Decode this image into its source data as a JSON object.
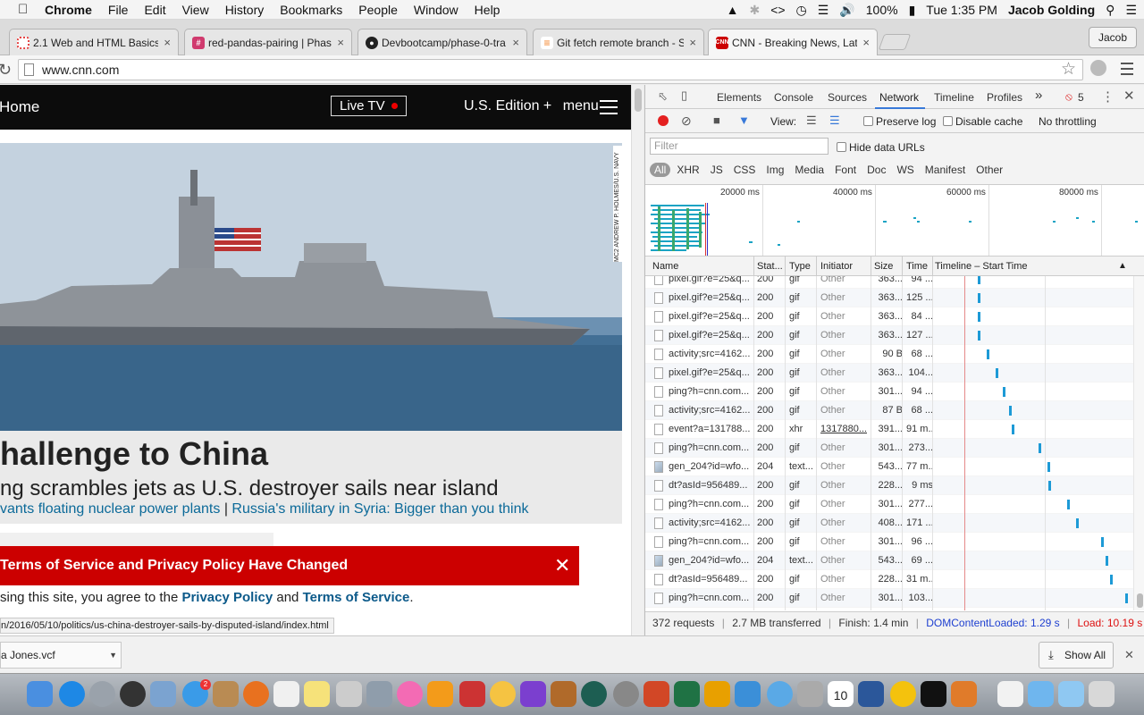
{
  "menubar": {
    "app": "Chrome",
    "items": [
      "File",
      "Edit",
      "View",
      "History",
      "Bookmarks",
      "People",
      "Window",
      "Help"
    ],
    "battery": "100%",
    "clock": "Tue 1:35 PM",
    "user": "Jacob Golding"
  },
  "tabs": [
    {
      "title": "2.1 Web and HTML Basics",
      "icon": "progress-icon",
      "color": "#e54545"
    },
    {
      "title": "red-pandas-pairing | Phase",
      "icon": "slack-icon",
      "color": "#d03a6e"
    },
    {
      "title": "Devbootcamp/phase-0-tra",
      "icon": "github-icon",
      "color": "#222222"
    },
    {
      "title": "Git fetch remote branch - S",
      "icon": "stackoverflow-icon",
      "color": "#f48024"
    },
    {
      "title": "CNN - Breaking News, Late",
      "icon": "cnn-icon",
      "color": "#cc0000"
    }
  ],
  "profile": "Jacob",
  "address": "www.cnn.com",
  "cnn": {
    "home": "Home",
    "live_tv": "Live TV",
    "edition": "U.S. Edition +",
    "menu": "menu",
    "photo_credit": "MC2 ANDREW P. HOLMES/U.S. NAVY",
    "headline": "hallenge to China",
    "subhead": "ng scrambles jets as U.S. destroyer sails near island",
    "link1": "vants floating nuclear power plants",
    "link_sep": " | ",
    "link2": "Russia's military in Syria: Bigger than you think",
    "tos_title": "Terms of Service and Privacy Policy Have Changed",
    "tos_prefix": "sing this site, you agree to the ",
    "tos_privacy": "Privacy Policy",
    "tos_and": " and ",
    "tos_terms": "Terms of Service",
    "tos_end": ".",
    "status_url": "n/2016/05/10/politics/us-china-destroyer-sails-by-disputed-island/index.html"
  },
  "devtools": {
    "tabs": [
      "Elements",
      "Console",
      "Sources",
      "Network",
      "Timeline",
      "Profiles"
    ],
    "active_tab": "Network",
    "more": "»",
    "errors": "5",
    "view_label": "View:",
    "preserve_log": "Preserve log",
    "disable_cache": "Disable cache",
    "throttling": "No throttling",
    "filter_placeholder": "Filter",
    "hide_data_urls": "Hide data URLs",
    "types": [
      "All",
      "XHR",
      "JS",
      "CSS",
      "Img",
      "Media",
      "Font",
      "Doc",
      "WS",
      "Manifest",
      "Other"
    ],
    "overview_ticks": [
      "20000 ms",
      "40000 ms",
      "60000 ms",
      "80000 ms"
    ],
    "columns": [
      "Name",
      "Stat...",
      "Type",
      "Initiator",
      "Size",
      "Time",
      "Timeline – Start Time"
    ],
    "rows": [
      {
        "name": "pixel.gif?e=25&q...",
        "status": "200",
        "type": "gif",
        "initiator": "Other",
        "size": "363...",
        "time": "94 ...",
        "bar": 0.1,
        "icon": "plain"
      },
      {
        "name": "pixel.gif?e=25&q...",
        "status": "200",
        "type": "gif",
        "initiator": "Other",
        "size": "363...",
        "time": "125 ...",
        "bar": 0.1,
        "icon": "plain"
      },
      {
        "name": "pixel.gif?e=25&q...",
        "status": "200",
        "type": "gif",
        "initiator": "Other",
        "size": "363...",
        "time": "84 ...",
        "bar": 0.1,
        "icon": "plain"
      },
      {
        "name": "pixel.gif?e=25&q...",
        "status": "200",
        "type": "gif",
        "initiator": "Other",
        "size": "363...",
        "time": "127 ...",
        "bar": 0.1,
        "icon": "plain"
      },
      {
        "name": "activity;src=4162...",
        "status": "200",
        "type": "gif",
        "initiator": "Other",
        "size": "90 B",
        "time": "68 ...",
        "bar": 0.12,
        "icon": "plain"
      },
      {
        "name": "pixel.gif?e=25&q...",
        "status": "200",
        "type": "gif",
        "initiator": "Other",
        "size": "363...",
        "time": "104...",
        "bar": 0.14,
        "icon": "plain"
      },
      {
        "name": "ping?h=cnn.com...",
        "status": "200",
        "type": "gif",
        "initiator": "Other",
        "size": "301...",
        "time": "94 ...",
        "bar": 0.155,
        "icon": "plain"
      },
      {
        "name": "activity;src=4162...",
        "status": "200",
        "type": "gif",
        "initiator": "Other",
        "size": "87 B",
        "time": "68 ...",
        "bar": 0.17,
        "icon": "plain"
      },
      {
        "name": "event?a=131788...",
        "status": "200",
        "type": "xhr",
        "initiator": "1317880...",
        "size": "391...",
        "time": "91 m...",
        "bar": 0.175,
        "icon": "plain",
        "initiator_link": true
      },
      {
        "name": "ping?h=cnn.com...",
        "status": "200",
        "type": "gif",
        "initiator": "Other",
        "size": "301...",
        "time": "273...",
        "bar": 0.235,
        "icon": "plain"
      },
      {
        "name": "gen_204?id=wfo...",
        "status": "204",
        "type": "text...",
        "initiator": "Other",
        "size": "543...",
        "time": "77 m...",
        "bar": 0.255,
        "icon": "img"
      },
      {
        "name": "dt?asId=956489...",
        "status": "200",
        "type": "gif",
        "initiator": "Other",
        "size": "228...",
        "time": "9 ms",
        "bar": 0.257,
        "icon": "plain"
      },
      {
        "name": "ping?h=cnn.com...",
        "status": "200",
        "type": "gif",
        "initiator": "Other",
        "size": "301...",
        "time": "277...",
        "bar": 0.3,
        "icon": "plain"
      },
      {
        "name": "activity;src=4162...",
        "status": "200",
        "type": "gif",
        "initiator": "Other",
        "size": "408...",
        "time": "171 ...",
        "bar": 0.32,
        "icon": "plain"
      },
      {
        "name": "ping?h=cnn.com...",
        "status": "200",
        "type": "gif",
        "initiator": "Other",
        "size": "301...",
        "time": "96 ...",
        "bar": 0.375,
        "icon": "plain"
      },
      {
        "name": "gen_204?id=wfo...",
        "status": "204",
        "type": "text...",
        "initiator": "Other",
        "size": "543...",
        "time": "69 ...",
        "bar": 0.385,
        "icon": "img"
      },
      {
        "name": "dt?asId=956489...",
        "status": "200",
        "type": "gif",
        "initiator": "Other",
        "size": "228...",
        "time": "31 m...",
        "bar": 0.395,
        "icon": "plain"
      },
      {
        "name": "ping?h=cnn.com...",
        "status": "200",
        "type": "gif",
        "initiator": "Other",
        "size": "301...",
        "time": "103...",
        "bar": 0.43,
        "icon": "plain"
      }
    ],
    "summary": {
      "requests": "372 requests",
      "transferred": "2.7 MB transferred",
      "finish": "Finish: 1.4 min",
      "dcl": "DOMContentLoaded: 1.29 s",
      "load": "Load: 10.19 s"
    }
  },
  "download": {
    "file": "a Jones.vcf",
    "show_all": "Show All"
  },
  "dock": {
    "badge": "2",
    "calendar_day": "10"
  },
  "colors": {
    "cnn_red": "#cc0000",
    "devtools_blue": "#3879d9",
    "bar_blue": "#1d9ad6"
  }
}
